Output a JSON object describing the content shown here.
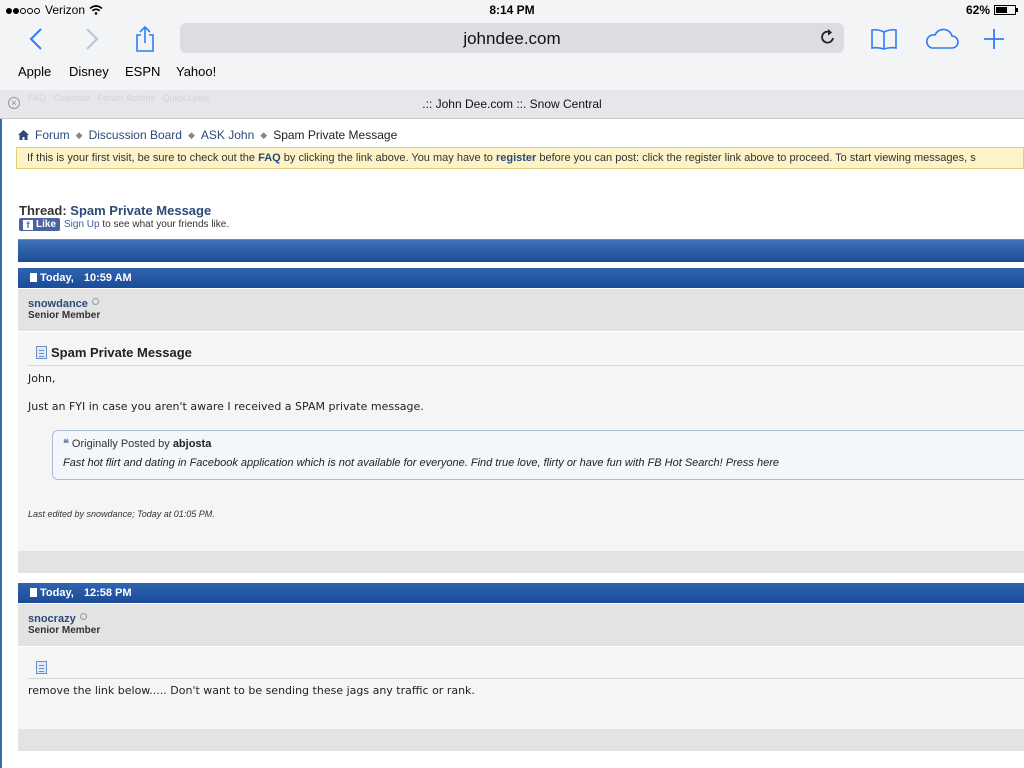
{
  "status_bar": {
    "carrier": "Verizon",
    "time": "8:14 PM",
    "battery": "62%",
    "battery_level": 0.62
  },
  "browser": {
    "url": "johndee.com",
    "bookmarks": [
      "Apple",
      "Disney",
      "ESPN",
      "Yahoo!"
    ],
    "tab_title": ".:: John Dee.com ::. Snow Central",
    "tab_ghost_items": [
      "FAQ",
      "Calendar",
      "Forum Actions",
      "Quick Links"
    ]
  },
  "breadcrumb": {
    "items": [
      "Forum",
      "Discussion Board",
      "ASK John"
    ],
    "current": "Spam Private Message"
  },
  "notice": {
    "t1": "If this is your first visit, be sure to check out the ",
    "faq": "FAQ",
    "t2": " by clicking the link above. You may have to ",
    "register": "register",
    "t3": " before you can post: click the register link above to proceed. To start viewing messages, s"
  },
  "thread": {
    "label": "Thread:",
    "title": "Spam Private Message"
  },
  "facebook": {
    "like": "Like",
    "signup": "Sign Up",
    "text": " to see what your friends like."
  },
  "posts": [
    {
      "date": "Today,",
      "time": "10:59 AM",
      "username": "snowdance",
      "rank": "Senior Member",
      "title": "Spam Private Message",
      "greeting": "John,",
      "body": "Just an FYI in case you aren't aware I received a SPAM private message.",
      "quote_label": "Originally Posted by",
      "quote_author": "abjosta",
      "quote_text": "Fast hot flirt and dating in Facebook application which is not available for everyone. Find true love, flirty or have fun with FB Hot Search! Press here",
      "edited": "Last edited by snowdance; Today at 01:05 PM."
    },
    {
      "date": "Today,",
      "time": "12:58 PM",
      "username": "snocrazy",
      "rank": "Senior Member",
      "body": "remove the link below..... Don't want to be sending these jags any traffic or rank."
    }
  ]
}
